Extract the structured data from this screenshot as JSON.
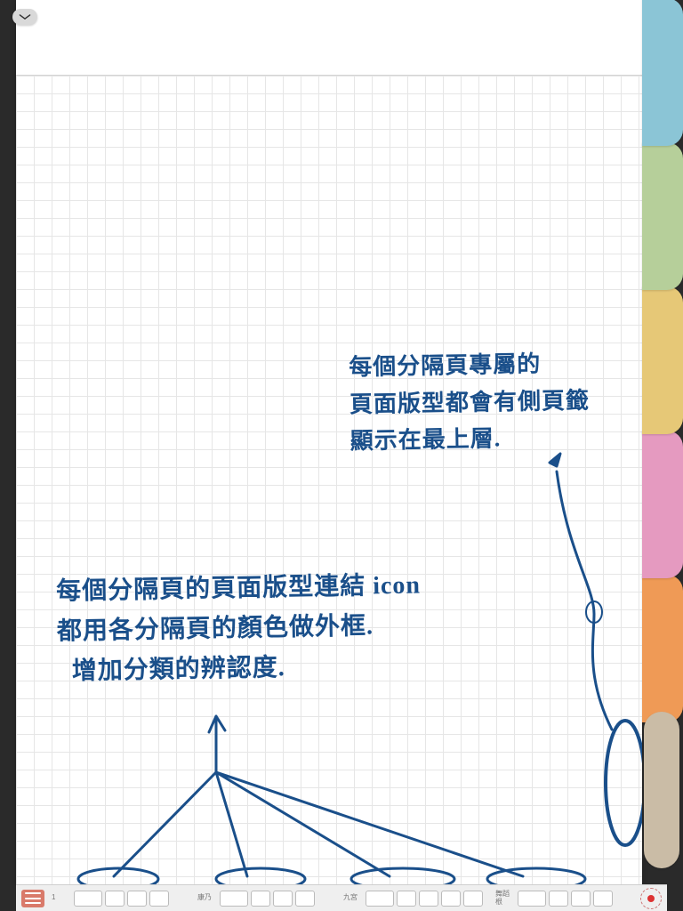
{
  "handwriting": {
    "right_block": "每個分隔頁專屬的\n頁面版型都會有側頁籤\n顯示在最上層.",
    "left_block": "每個分隔頁的頁面版型連結 icon\n都用各分隔頁的顏色做外框.\n  增加分類的辨認度."
  },
  "side_tabs": [
    {
      "color": "#8bc5d6"
    },
    {
      "color": "#b6cf9a"
    },
    {
      "color": "#e6c877"
    },
    {
      "color": "#e59ac0"
    },
    {
      "color": "#ef9a56"
    }
  ],
  "active_side_tab": {
    "color": "#cabca6"
  },
  "toolbar": {
    "groups": [
      {
        "label": "1",
        "slots": 4
      },
      {
        "label": "康乃",
        "slots": 4
      },
      {
        "label": "九宮",
        "slots": 5
      },
      {
        "label": "舞蹈\n根",
        "slots": 4
      }
    ]
  }
}
